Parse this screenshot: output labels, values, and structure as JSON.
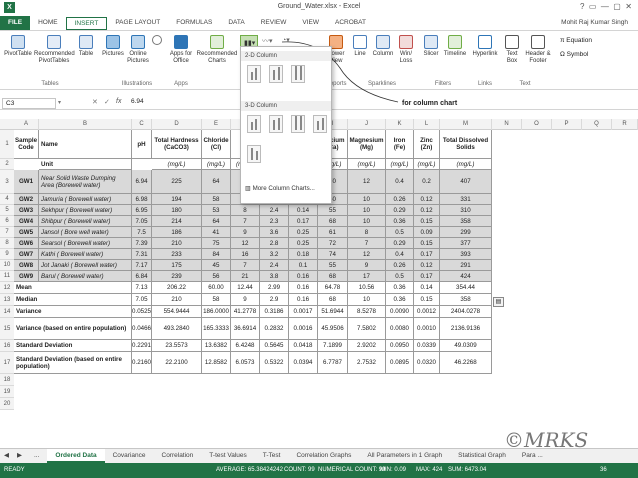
{
  "window": {
    "title": "Ground_Water.xlsx - Excel",
    "user": "Mohit Raj Kumar Singh"
  },
  "tabs": [
    "FILE",
    "HOME",
    "INSERT",
    "PAGE LAYOUT",
    "FORMULAS",
    "DATA",
    "REVIEW",
    "VIEW",
    "ACROBAT"
  ],
  "ribbon": {
    "buttons": {
      "pivot": "PivotTable",
      "rec_pivot": "Recommended PivotTables",
      "table": "Table",
      "pictures": "Pictures",
      "online_pictures": "Online Pictures",
      "apps": "Apps for Office",
      "rec_charts": "Recommended Charts",
      "power_view": "Power View",
      "line": "Line",
      "column": "Column",
      "winloss": "Win/ Loss",
      "slicer": "Slicer",
      "timeline": "Timeline",
      "hyperlink": "Hyperlink",
      "textbox": "Text Box",
      "header_footer": "Header & Footer",
      "equation": "Equation",
      "symbol": "Symbol"
    },
    "groups": {
      "tables": "Tables",
      "illustrations": "Illustrations",
      "apps": "Apps",
      "reports": "Reports",
      "sparklines": "Sparklines",
      "filters": "Filters",
      "links": "Links",
      "text": "Text"
    }
  },
  "dropdown": {
    "section1": "2-D Column",
    "section2": "3-D Column",
    "more": "More Column Charts..."
  },
  "annotation": "for column chart",
  "formula": {
    "cell": "C3",
    "value": "6.94"
  },
  "columns": [
    "A",
    "B",
    "C",
    "D",
    "E",
    "F",
    "G",
    "H",
    "I",
    "J",
    "K",
    "L",
    "M",
    "N",
    "O",
    "P",
    "Q",
    "R"
  ],
  "rows": [
    "1",
    "2",
    "3",
    "4",
    "5",
    "6",
    "7",
    "8",
    "9",
    "10",
    "11",
    "12",
    "13",
    "14",
    "15",
    "16",
    "17",
    "18",
    "19",
    "20"
  ],
  "headers": {
    "code": "Sample Code",
    "name": "Name",
    "ph": "pH",
    "hardness": "Total Hardness (CaCO3)",
    "chloride": "Chloride (Cl)",
    "sulfate": "Su",
    "calcium": "Calcium (Ca)",
    "magnesium": "Magnesium (Mg)",
    "iron": "Iron (Fe)",
    "zinc": "Zinc (Zn)",
    "tds": "Total Dissolved Solids",
    "unit": "Unit",
    "mgl": "(mg/L)"
  },
  "samples": [
    {
      "code": "GW1",
      "name": "Near Solid Waste Dumping Area (Borewell water)",
      "ph": "6.94",
      "d": "225",
      "e": "64",
      "f": "",
      "g": "",
      "h": "",
      "i": "70",
      "j": "12",
      "k": "0.4",
      "l": "0.2",
      "m": "407"
    },
    {
      "code": "GW2",
      "name": "Jamuria ( Borewell water)",
      "ph": "6.98",
      "d": "194",
      "e": "58",
      "f": "8",
      "g": "2.9",
      "h": "0.13",
      "i": "60",
      "j": "10",
      "k": "0.26",
      "l": "0.12",
      "m": "331"
    },
    {
      "code": "GW3",
      "name": "Sekhpur ( Borewell water)",
      "ph": "6.95",
      "d": "180",
      "e": "53",
      "f": "8",
      "g": "2.4",
      "h": "0.14",
      "i": "55",
      "j": "10",
      "k": "0.29",
      "l": "0.12",
      "m": "310"
    },
    {
      "code": "GW4",
      "name": "Shibpur ( Borewell water)",
      "ph": "7.05",
      "d": "214",
      "e": "64",
      "f": "7",
      "g": "2.3",
      "h": "0.17",
      "i": "68",
      "j": "10",
      "k": "0.36",
      "l": "0.15",
      "m": "358"
    },
    {
      "code": "GW5",
      "name": "Jansol ( Bore well water)",
      "ph": "7.5",
      "d": "186",
      "e": "41",
      "f": "9",
      "g": "3.6",
      "h": "0.25",
      "i": "61",
      "j": "8",
      "k": "0.5",
      "l": "0.09",
      "m": "299"
    },
    {
      "code": "GW6",
      "name": "Searsol ( Borewell water)",
      "ph": "7.39",
      "d": "210",
      "e": "75",
      "f": "12",
      "g": "2.8",
      "h": "0.25",
      "i": "72",
      "j": "7",
      "k": "0.29",
      "l": "0.15",
      "m": "377"
    },
    {
      "code": "GW7",
      "name": "Kathi ( Borewell water)",
      "ph": "7.31",
      "d": "233",
      "e": "84",
      "f": "16",
      "g": "3.2",
      "h": "0.18",
      "i": "74",
      "j": "12",
      "k": "0.4",
      "l": "0.17",
      "m": "393"
    },
    {
      "code": "GW8",
      "name": "Jot Janaki ( Borewell water)",
      "ph": "7.17",
      "d": "175",
      "e": "45",
      "f": "7",
      "g": "2.4",
      "h": "0.1",
      "i": "55",
      "j": "9",
      "k": "0.26",
      "l": "0.12",
      "m": "291"
    },
    {
      "code": "GW9",
      "name": "Barul ( Borewell water)",
      "ph": "6.84",
      "d": "239",
      "e": "56",
      "f": "21",
      "g": "3.8",
      "h": "0.16",
      "i": "68",
      "j": "17",
      "k": "0.5",
      "l": "0.17",
      "m": "424"
    }
  ],
  "stats": [
    {
      "label": "Mean",
      "ph": "7.13",
      "d": "206.22",
      "e": "60.00",
      "f": "12.44",
      "g": "2.99",
      "h": "0.16",
      "i": "64.78",
      "j": "10.56",
      "k": "0.36",
      "l": "0.14",
      "m": "354.44"
    },
    {
      "label": "Median",
      "ph": "7.05",
      "d": "210",
      "e": "58",
      "f": "9",
      "g": "2.9",
      "h": "0.16",
      "i": "68",
      "j": "10",
      "k": "0.36",
      "l": "0.15",
      "m": "358"
    },
    {
      "label": "Variance",
      "ph": "0.0525",
      "d": "554.9444",
      "e": "186.0000",
      "f": "41.2778",
      "g": "0.3186",
      "h": "0.0017",
      "i": "51.6944",
      "j": "8.5278",
      "k": "0.0090",
      "l": "0.0012",
      "m": "2404.0278"
    },
    {
      "label": "Variance (based on entire population)",
      "ph": "0.0466",
      "d": "493.2840",
      "e": "165.3333",
      "f": "36.6914",
      "g": "0.2832",
      "h": "0.0016",
      "i": "45.9506",
      "j": "7.5802",
      "k": "0.0080",
      "l": "0.0010",
      "m": "2136.9136"
    },
    {
      "label": "Standard Deviation",
      "ph": "0.2291",
      "d": "23.5573",
      "e": "13.6382",
      "f": "6.4248",
      "g": "0.5645",
      "h": "0.0418",
      "i": "7.1899",
      "j": "2.9202",
      "k": "0.0950",
      "l": "0.0339",
      "m": "49.0309"
    },
    {
      "label": "Standard Deviation (based on entire population)",
      "ph": "0.2160",
      "d": "22.2100",
      "e": "12.8582",
      "f": "6.0573",
      "g": "0.5322",
      "h": "0.0394",
      "i": "6.7787",
      "j": "2.7532",
      "k": "0.0895",
      "l": "0.0320",
      "m": "46.2268"
    }
  ],
  "sheets": [
    "...",
    "Ordered Data",
    "Covariance",
    "Correlation",
    "T-test Values",
    "T-Test",
    "Correlation Graphs",
    "All Parameters in 1 Graph",
    "Statistical Graph",
    "Para ..."
  ],
  "status": {
    "ready": "READY",
    "average": "AVERAGE: 65.38424242",
    "count": "COUNT: 99",
    "numcount": "NUMERICAL COUNT: 99",
    "min": "MIN: 0.09",
    "max": "MAX: 424",
    "sum": "SUM: 6473.04",
    "zoom": "36"
  },
  "watermark": "©MRKS"
}
